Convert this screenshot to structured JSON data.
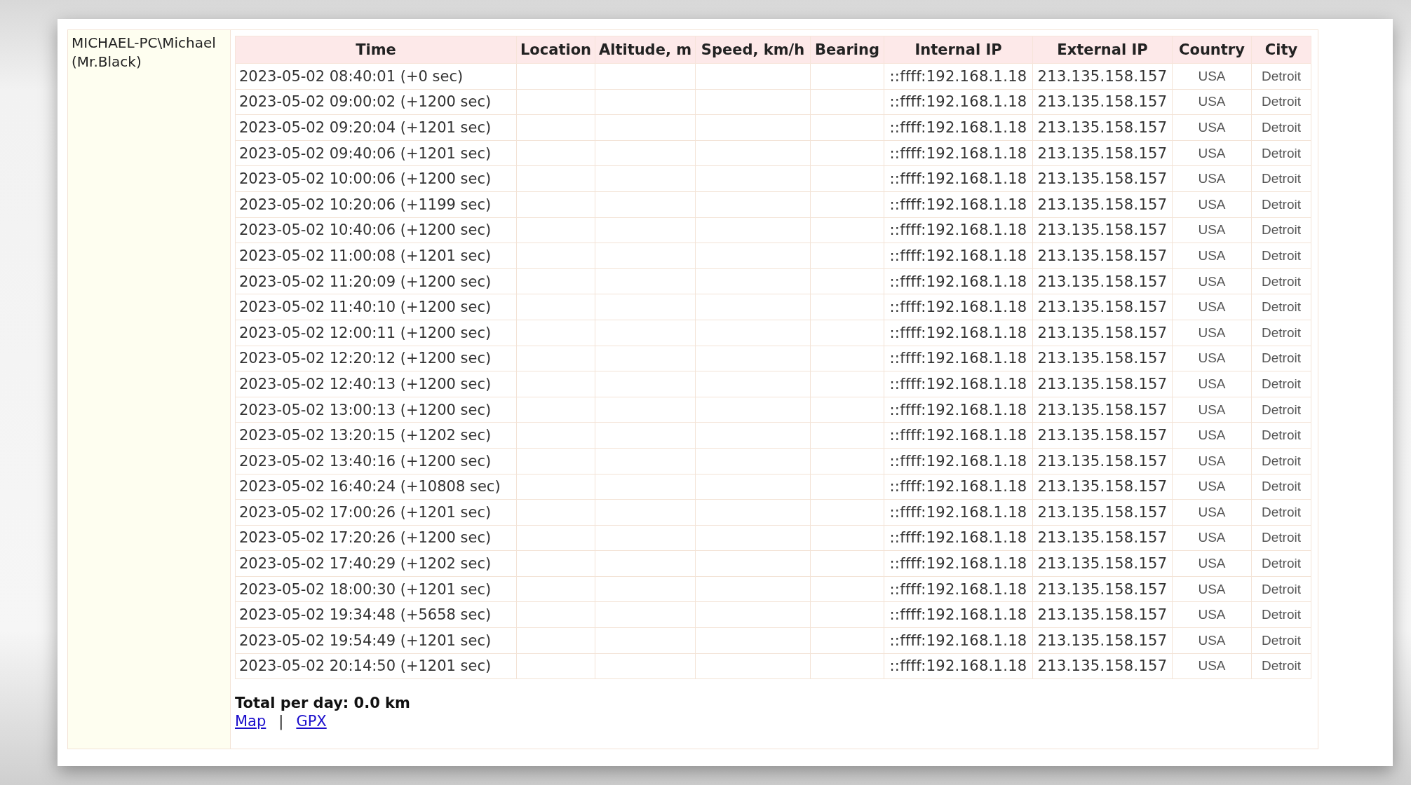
{
  "user": "MICHAEL-PC\\Michael (Mr.Black)",
  "table": {
    "columns": [
      "Time",
      "Location",
      "Altitude, m",
      "Speed, km/h",
      "Bearing",
      "Internal IP",
      "External IP",
      "Country",
      "City"
    ],
    "rows": [
      {
        "time": "2023-05-02 08:40:01 (+0 sec)",
        "internal_ip": "::ffff:192.168.1.18",
        "external_ip": "213.135.158.157",
        "country": "USA",
        "city": "Detroit"
      },
      {
        "time": "2023-05-02 09:00:02 (+1200 sec)",
        "internal_ip": "::ffff:192.168.1.18",
        "external_ip": "213.135.158.157",
        "country": "USA",
        "city": "Detroit"
      },
      {
        "time": "2023-05-02 09:20:04 (+1201 sec)",
        "internal_ip": "::ffff:192.168.1.18",
        "external_ip": "213.135.158.157",
        "country": "USA",
        "city": "Detroit"
      },
      {
        "time": "2023-05-02 09:40:06 (+1201 sec)",
        "internal_ip": "::ffff:192.168.1.18",
        "external_ip": "213.135.158.157",
        "country": "USA",
        "city": "Detroit"
      },
      {
        "time": "2023-05-02 10:00:06 (+1200 sec)",
        "internal_ip": "::ffff:192.168.1.18",
        "external_ip": "213.135.158.157",
        "country": "USA",
        "city": "Detroit"
      },
      {
        "time": "2023-05-02 10:20:06 (+1199 sec)",
        "internal_ip": "::ffff:192.168.1.18",
        "external_ip": "213.135.158.157",
        "country": "USA",
        "city": "Detroit"
      },
      {
        "time": "2023-05-02 10:40:06 (+1200 sec)",
        "internal_ip": "::ffff:192.168.1.18",
        "external_ip": "213.135.158.157",
        "country": "USA",
        "city": "Detroit"
      },
      {
        "time": "2023-05-02 11:00:08 (+1201 sec)",
        "internal_ip": "::ffff:192.168.1.18",
        "external_ip": "213.135.158.157",
        "country": "USA",
        "city": "Detroit"
      },
      {
        "time": "2023-05-02 11:20:09 (+1200 sec)",
        "internal_ip": "::ffff:192.168.1.18",
        "external_ip": "213.135.158.157",
        "country": "USA",
        "city": "Detroit"
      },
      {
        "time": "2023-05-02 11:40:10 (+1200 sec)",
        "internal_ip": "::ffff:192.168.1.18",
        "external_ip": "213.135.158.157",
        "country": "USA",
        "city": "Detroit"
      },
      {
        "time": "2023-05-02 12:00:11 (+1200 sec)",
        "internal_ip": "::ffff:192.168.1.18",
        "external_ip": "213.135.158.157",
        "country": "USA",
        "city": "Detroit"
      },
      {
        "time": "2023-05-02 12:20:12 (+1200 sec)",
        "internal_ip": "::ffff:192.168.1.18",
        "external_ip": "213.135.158.157",
        "country": "USA",
        "city": "Detroit"
      },
      {
        "time": "2023-05-02 12:40:13 (+1200 sec)",
        "internal_ip": "::ffff:192.168.1.18",
        "external_ip": "213.135.158.157",
        "country": "USA",
        "city": "Detroit"
      },
      {
        "time": "2023-05-02 13:00:13 (+1200 sec)",
        "internal_ip": "::ffff:192.168.1.18",
        "external_ip": "213.135.158.157",
        "country": "USA",
        "city": "Detroit"
      },
      {
        "time": "2023-05-02 13:20:15 (+1202 sec)",
        "internal_ip": "::ffff:192.168.1.18",
        "external_ip": "213.135.158.157",
        "country": "USA",
        "city": "Detroit"
      },
      {
        "time": "2023-05-02 13:40:16 (+1200 sec)",
        "internal_ip": "::ffff:192.168.1.18",
        "external_ip": "213.135.158.157",
        "country": "USA",
        "city": "Detroit"
      },
      {
        "time": "2023-05-02 16:40:24 (+10808 sec)",
        "internal_ip": "::ffff:192.168.1.18",
        "external_ip": "213.135.158.157",
        "country": "USA",
        "city": "Detroit"
      },
      {
        "time": "2023-05-02 17:00:26 (+1201 sec)",
        "internal_ip": "::ffff:192.168.1.18",
        "external_ip": "213.135.158.157",
        "country": "USA",
        "city": "Detroit"
      },
      {
        "time": "2023-05-02 17:20:26 (+1200 sec)",
        "internal_ip": "::ffff:192.168.1.18",
        "external_ip": "213.135.158.157",
        "country": "USA",
        "city": "Detroit"
      },
      {
        "time": "2023-05-02 17:40:29 (+1202 sec)",
        "internal_ip": "::ffff:192.168.1.18",
        "external_ip": "213.135.158.157",
        "country": "USA",
        "city": "Detroit"
      },
      {
        "time": "2023-05-02 18:00:30 (+1201 sec)",
        "internal_ip": "::ffff:192.168.1.18",
        "external_ip": "213.135.158.157",
        "country": "USA",
        "city": "Detroit"
      },
      {
        "time": "2023-05-02 19:34:48 (+5658 sec)",
        "internal_ip": "::ffff:192.168.1.18",
        "external_ip": "213.135.158.157",
        "country": "USA",
        "city": "Detroit"
      },
      {
        "time": "2023-05-02 19:54:49 (+1201 sec)",
        "internal_ip": "::ffff:192.168.1.18",
        "external_ip": "213.135.158.157",
        "country": "USA",
        "city": "Detroit"
      },
      {
        "time": "2023-05-02 20:14:50 (+1201 sec)",
        "internal_ip": "::ffff:192.168.1.18",
        "external_ip": "213.135.158.157",
        "country": "USA",
        "city": "Detroit"
      }
    ]
  },
  "total": "Total per day: 0.0 km",
  "links": [
    "Map",
    "GPX"
  ],
  "link_separator": "|"
}
